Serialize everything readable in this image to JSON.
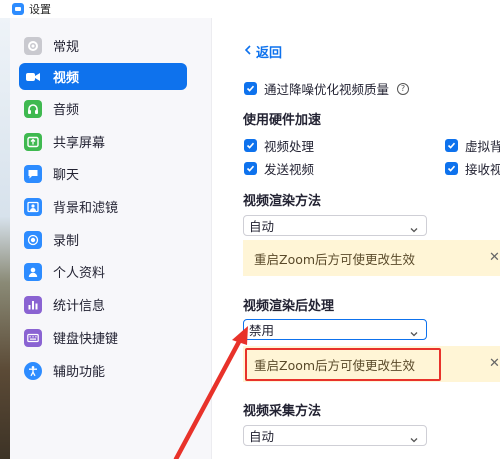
{
  "window": {
    "title": "设置"
  },
  "sidebar": {
    "items": [
      {
        "label": "常规",
        "icon": "gear-icon",
        "active": false
      },
      {
        "label": "视频",
        "icon": "video-camera-icon",
        "active": true
      },
      {
        "label": "音频",
        "icon": "headphones-icon",
        "active": false
      },
      {
        "label": "共享屏幕",
        "icon": "share-screen-icon",
        "active": false
      },
      {
        "label": "聊天",
        "icon": "chat-bubble-icon",
        "active": false
      },
      {
        "label": "背景和滤镜",
        "icon": "background-icon",
        "active": false
      },
      {
        "label": "录制",
        "icon": "record-icon",
        "active": false
      },
      {
        "label": "个人资料",
        "icon": "person-icon",
        "active": false
      },
      {
        "label": "统计信息",
        "icon": "bar-chart-icon",
        "active": false
      },
      {
        "label": "键盘快捷键",
        "icon": "keyboard-icon",
        "active": false
      },
      {
        "label": "辅助功能",
        "icon": "accessibility-icon",
        "active": false
      }
    ]
  },
  "main": {
    "back_label": "返回",
    "noise_option": "通过降噪优化视频质量",
    "hw_accel": {
      "title": "使用硬件加速",
      "options": [
        "视频处理",
        "虚拟背",
        "发送视频",
        "接收视"
      ]
    },
    "render_method": {
      "title": "视频渲染方法",
      "value": "自动",
      "notice": "重启Zoom后方可使更改生效"
    },
    "post_processing": {
      "title": "视频渲染后处理",
      "value": "禁用",
      "notice": "重启Zoom后方可使更改生效"
    },
    "capture_method": {
      "title": "视频采集方法",
      "value": "自动"
    }
  },
  "colors": {
    "accent": "#0e72ed",
    "notice_bg": "#fff5d6",
    "annotation": "#e8322a"
  }
}
